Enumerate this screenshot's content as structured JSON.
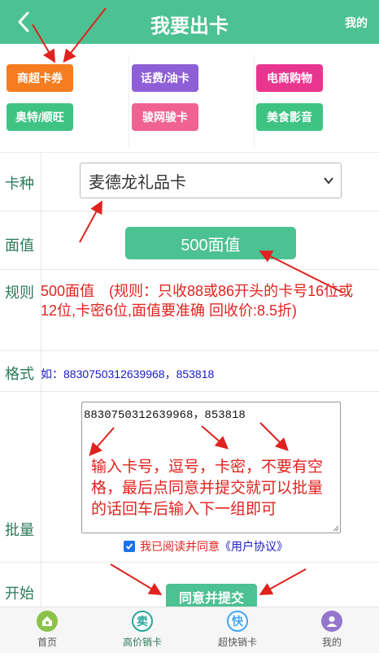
{
  "header": {
    "title": "我要出卡",
    "right_link": "我的"
  },
  "categories": [
    {
      "label": "商超卡券",
      "color": "#f57c1f"
    },
    {
      "label": "话费/油卡",
      "color": "#8e5fd6"
    },
    {
      "label": "电商购物",
      "color": "#e8368f"
    },
    {
      "label": "奥特/顺旺",
      "color": "#3ec383"
    },
    {
      "label": "骏网骏卡",
      "color": "#f06292"
    },
    {
      "label": "美食影音",
      "color": "#3ec383"
    }
  ],
  "form": {
    "card_type_label": "卡种",
    "card_type_value": "麦德龙礼品卡",
    "denomination_label": "面值",
    "denomination_value": "500面值",
    "rule_label": "规则",
    "rule_text": "500面值　(规则：只收88或86开头的卡号16位或12位,卡密6位,面值要准确 回收价:8.5折)",
    "format_label": "格式",
    "format_text": "如：8830750312639968，853818",
    "batch_label": "批量",
    "batch_value": "8830750312639968，853818",
    "agree_text": "我已阅读并同意",
    "agree_link": "《用户协议》",
    "start_label": "开始",
    "submit_label": "同意并提交"
  },
  "annotation_hint": "输入卡号，逗号，卡密，不要有空格，最后点同意并提交就可以批量的话回车后输入下一组即可",
  "tabbar": [
    {
      "label": "首页",
      "icon": "home-icon",
      "glyph": "",
      "color": "#8bc34a",
      "text_color": "#555"
    },
    {
      "label": "高价销卡",
      "icon": "mai-icon",
      "glyph": "卖",
      "color": "#26a69a",
      "text_color": "#2a7a5a"
    },
    {
      "label": "超快销卡",
      "icon": "kuai-icon",
      "glyph": "快",
      "color": "#42a5f5",
      "text_color": "#555"
    },
    {
      "label": "我的",
      "icon": "user-icon",
      "glyph": "",
      "color": "#9575cd",
      "text_color": "#555"
    }
  ],
  "colors": {
    "primary": "#4cc192",
    "annotation_red": "#e0231f",
    "link_blue": "#1a1ac8"
  }
}
